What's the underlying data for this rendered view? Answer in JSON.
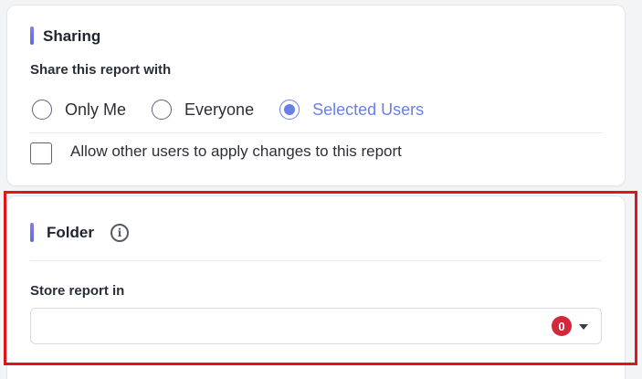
{
  "sharing": {
    "title": "Sharing",
    "share_with_label": "Share this report with",
    "options": [
      {
        "label": "Only Me",
        "selected": false
      },
      {
        "label": "Everyone",
        "selected": false
      },
      {
        "label": "Selected Users",
        "selected": true
      }
    ],
    "allow_changes_label": "Allow other users to apply changes to this report",
    "allow_changes_checked": false
  },
  "folder": {
    "title": "Folder",
    "store_label": "Store report in",
    "select_value": "",
    "badge_count": "0",
    "info_icon": "info-icon",
    "caret_icon": "chevron-down-icon"
  },
  "colors": {
    "accent": "#6a7fe6",
    "badge": "#d1283a",
    "highlight_border": "#e0151b"
  }
}
